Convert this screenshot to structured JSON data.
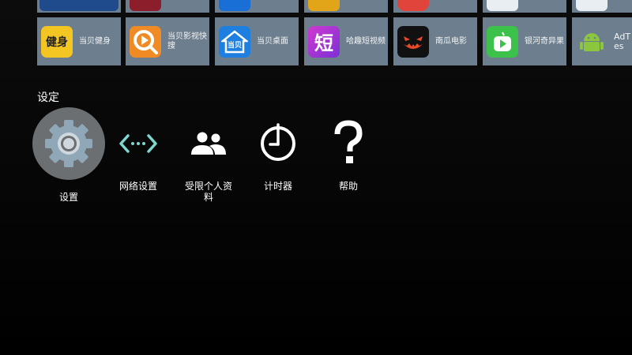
{
  "top_row": {
    "tiles": [
      {
        "name": "top-tile-1",
        "color": "#1f4a8c"
      },
      {
        "name": "top-tile-2",
        "color": "#8b1e2a"
      },
      {
        "name": "top-tile-3",
        "color": "#1a6fd6"
      },
      {
        "name": "top-tile-4",
        "color": "#e2a418"
      },
      {
        "name": "top-tile-5",
        "color": "#e0443a"
      },
      {
        "name": "top-tile-6",
        "color": "#e9eef2"
      },
      {
        "name": "top-tile-7",
        "color": "#e9eef2"
      }
    ]
  },
  "apps": [
    {
      "label": "当贝健身",
      "icon_text": "健身",
      "icon": "fitness-icon",
      "color": "#f3c623"
    },
    {
      "label": "当贝影视快搜",
      "icon": "search-video-icon",
      "color": "#f08a24"
    },
    {
      "label": "当贝桌面",
      "icon_text": "当贝",
      "icon": "home-desktop-icon",
      "color": "#1e7fe0"
    },
    {
      "label": "哈趣短视频",
      "icon_text": "短",
      "icon": "short-video-icon",
      "color": "#b43ad6"
    },
    {
      "label": "南瓜电影",
      "icon": "pumpkin-icon",
      "color": "#111111"
    },
    {
      "label": "银河奇异果",
      "icon": "kiwi-tv-icon",
      "color": "#3cc24a"
    },
    {
      "label": "AdTes",
      "icon": "android-icon",
      "color": "#7fb93c"
    }
  ],
  "settings_section": {
    "title": "设定",
    "items": [
      {
        "label": "设置",
        "icon": "gear-icon"
      },
      {
        "label": "网络设置",
        "icon": "network-arrows-icon"
      },
      {
        "label": "受限个人资料",
        "icon": "users-icon"
      },
      {
        "label": "计时器",
        "icon": "timer-icon"
      },
      {
        "label": "帮助",
        "icon": "help-icon"
      }
    ]
  }
}
